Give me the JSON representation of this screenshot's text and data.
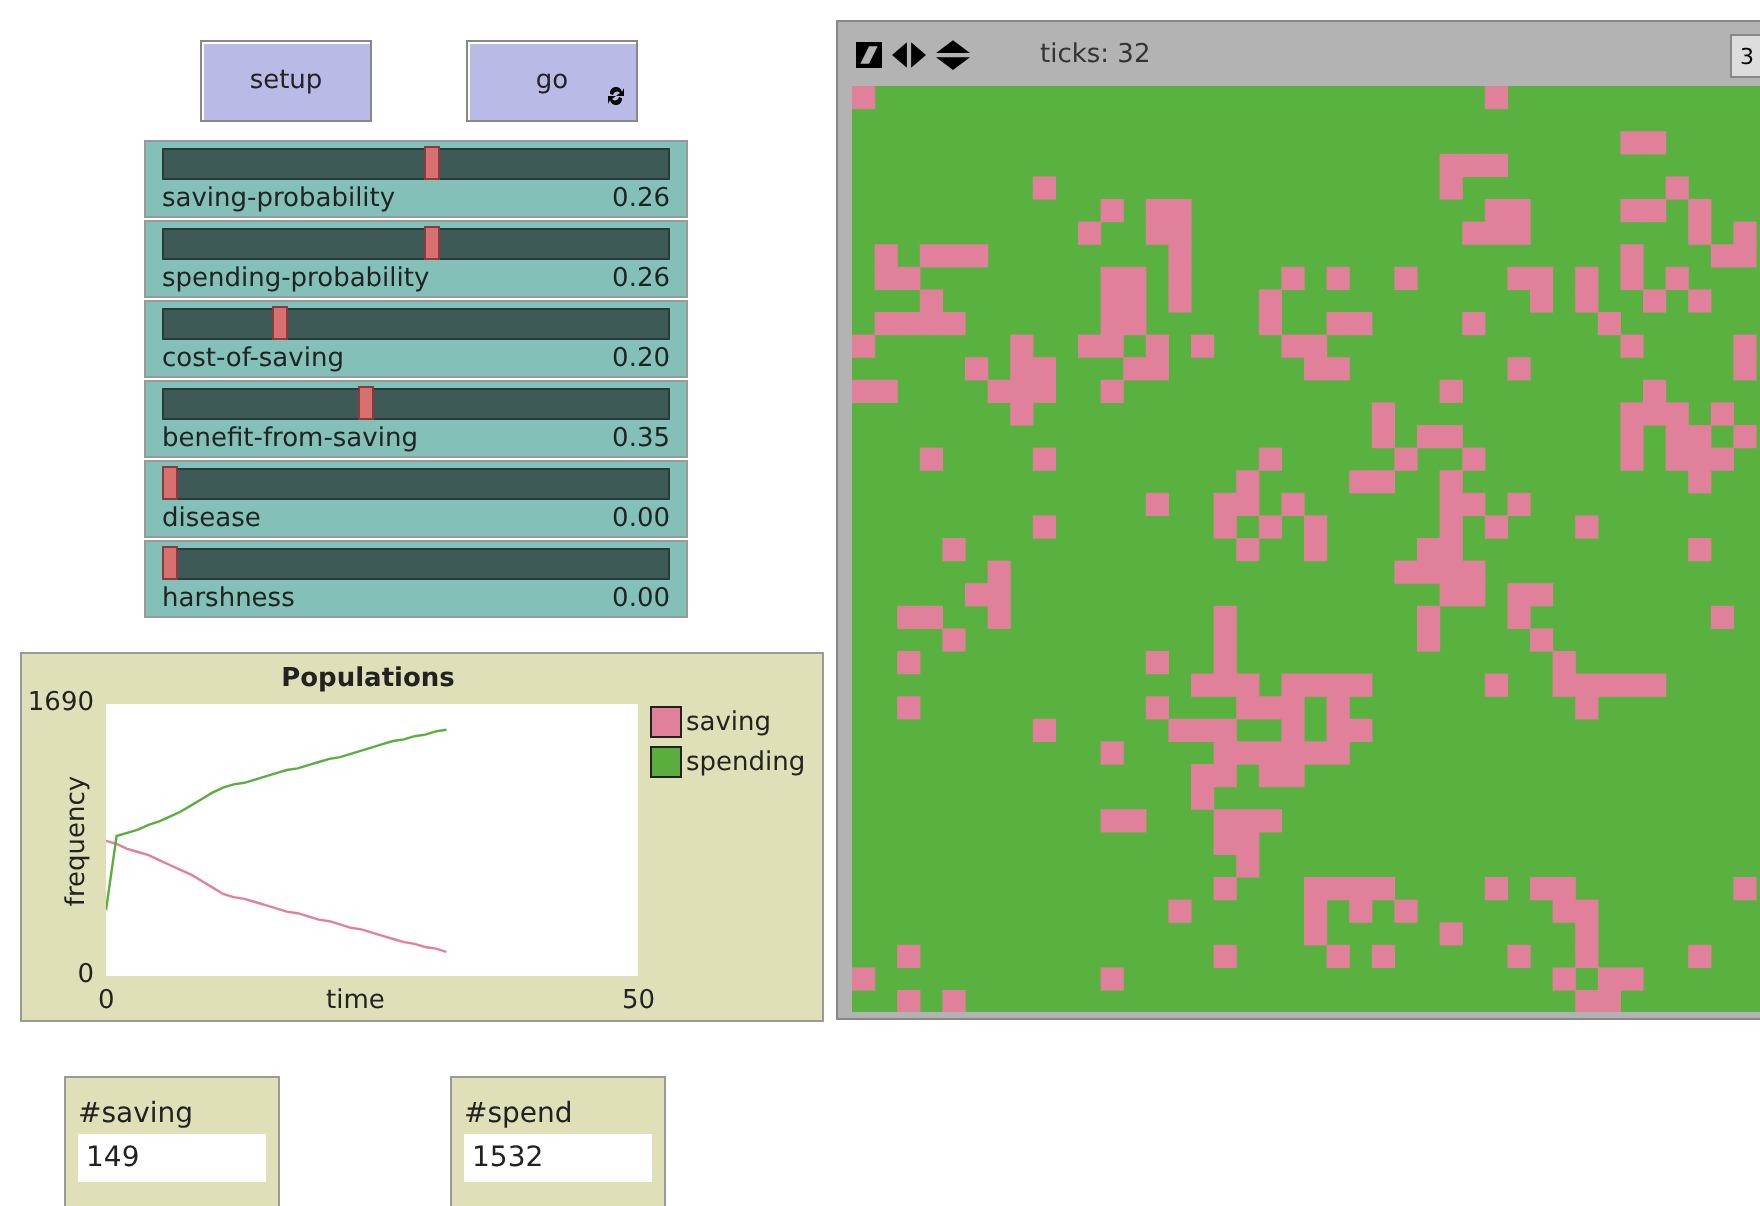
{
  "buttons": [
    {
      "label": "setup",
      "forever": false
    },
    {
      "label": "go",
      "forever": true
    }
  ],
  "sliders": [
    {
      "name": "saving-probability",
      "reading": "0.26",
      "level": 0.52
    },
    {
      "name": "spending-probability",
      "reading": "0.26",
      "level": 0.52
    },
    {
      "name": "cost-of-saving",
      "reading": "0.20",
      "level": 0.22
    },
    {
      "name": "benefit-from-saving",
      "reading": "0.35",
      "level": 0.39
    },
    {
      "name": "disease",
      "reading": "0.00",
      "level": 0
    },
    {
      "name": "harshness",
      "reading": "0.00",
      "level": 0
    }
  ],
  "plot": {
    "chart_data": {
      "type": "line",
      "title": "Populations",
      "xlabel": "time",
      "ylabel": "frequency",
      "xlim": [
        0,
        50
      ],
      "ylim": [
        0,
        1690
      ],
      "xticks": [
        0,
        50
      ],
      "yticks": [
        0,
        1690
      ],
      "x": [
        0,
        1,
        2,
        3,
        4,
        5,
        6,
        7,
        8,
        9,
        10,
        11,
        12,
        13,
        14,
        15,
        16,
        17,
        18,
        19,
        20,
        21,
        22,
        23,
        24,
        25,
        26,
        27,
        28,
        29,
        30,
        31,
        32
      ],
      "legend": "right",
      "series": [
        {
          "name": "saving",
          "color": "#e0809a",
          "values": [
            840,
            820,
            790,
            770,
            750,
            720,
            690,
            660,
            630,
            590,
            550,
            510,
            490,
            480,
            460,
            440,
            420,
            400,
            390,
            370,
            350,
            340,
            320,
            300,
            290,
            270,
            250,
            230,
            210,
            200,
            180,
            170,
            150
          ]
        },
        {
          "name": "spending",
          "color": "#5aae3e",
          "values": [
            410,
            870,
            890,
            910,
            940,
            960,
            990,
            1020,
            1060,
            1100,
            1140,
            1170,
            1190,
            1200,
            1220,
            1240,
            1260,
            1280,
            1290,
            1310,
            1330,
            1350,
            1360,
            1380,
            1400,
            1420,
            1440,
            1460,
            1470,
            1490,
            1500,
            1520,
            1530
          ]
        }
      ]
    }
  },
  "monitors": [
    {
      "label": "#saving",
      "value": "149"
    },
    {
      "label": "#spend",
      "value": "1532"
    }
  ],
  "view": {
    "ticks_label": "ticks: 32",
    "button_3d": "3"
  }
}
